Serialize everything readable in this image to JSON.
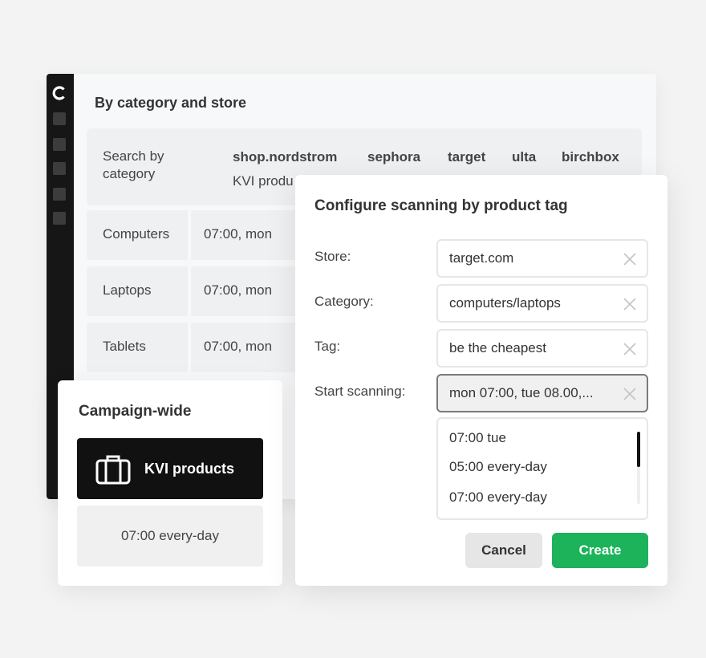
{
  "main": {
    "section_title": "By category and store",
    "search_label": "Search by category",
    "stores": [
      "shop.nordstrom",
      "sephora",
      "target",
      "ulta",
      "birchbox"
    ],
    "kvi_partial": "KVI produ",
    "rows": [
      {
        "category": "Computers",
        "time": "07:00, mon"
      },
      {
        "category": "Laptops",
        "time": "07:00, mon"
      },
      {
        "category": "Tablets",
        "time": "07:00, mon"
      }
    ]
  },
  "campaign": {
    "title": "Campaign-wide",
    "kvi_label": "KVI products",
    "kvi_icon": "briefcase-icon",
    "time": "07:00 every-day"
  },
  "dialog": {
    "title": "Configure scanning by product tag",
    "fields": [
      {
        "label": "Store:",
        "value": "target.com"
      },
      {
        "label": "Category:",
        "value": "computers/laptops"
      },
      {
        "label": "Tag:",
        "value": "be the cheapest"
      },
      {
        "label": "Start scanning:",
        "value": "mon 07:00, tue 08.00,..."
      }
    ],
    "options": [
      "07:00 tue",
      "05:00 every-day",
      "07:00 every-day"
    ],
    "cancel_label": "Cancel",
    "create_label": "Create"
  },
  "colors": {
    "accent": "#1cb35a",
    "sidebar": "#161616"
  }
}
